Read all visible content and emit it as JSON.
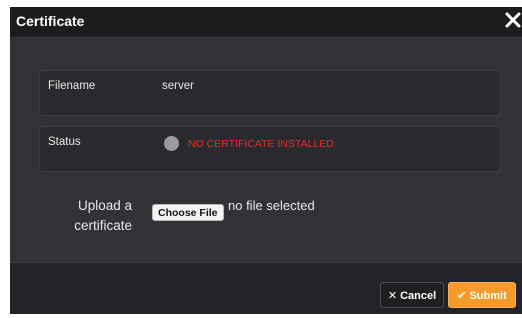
{
  "dialog": {
    "title": "Certificate",
    "close_icon": "close-icon"
  },
  "fields": {
    "filename_label": "Filename",
    "filename_value": "server",
    "status_label": "Status",
    "status_value": "NO CERTIFICATE INSTALLED",
    "status_color": "#e52a2a"
  },
  "upload": {
    "label": "Upload a certificate",
    "choose_button": "Choose File",
    "file_status": "no file selected"
  },
  "footer": {
    "cancel_icon": "x-icon",
    "cancel_label": "Cancel",
    "submit_icon": "check-icon",
    "submit_label": "Submit",
    "submit_color": "#f39a2a"
  }
}
